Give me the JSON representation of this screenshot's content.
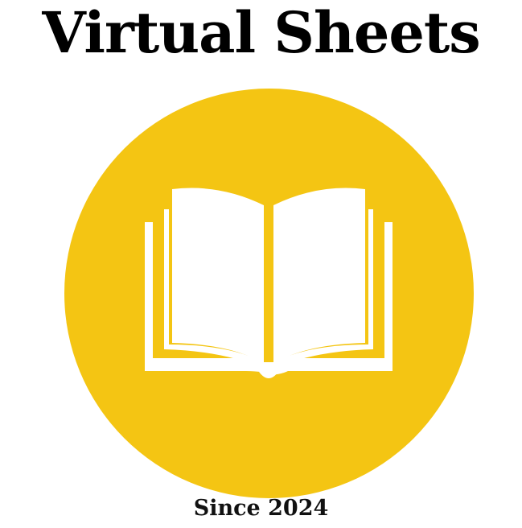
{
  "logo": {
    "title": "Virtual Sheets",
    "tagline": "Since 2024",
    "emblem_icon": "open-book-icon",
    "colors": {
      "circle": "#f4c513",
      "book": "#ffffff",
      "text": "#000000"
    }
  }
}
